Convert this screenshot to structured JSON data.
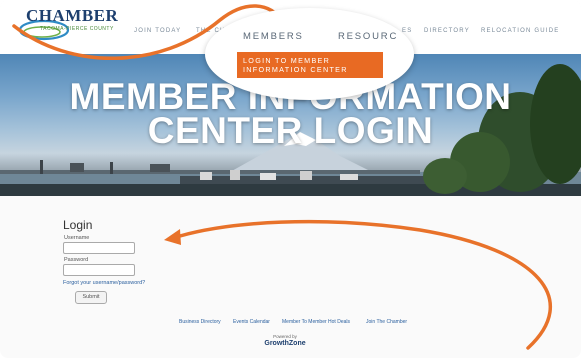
{
  "header": {
    "logo_text": "CHAMBER",
    "logo_subtext": "TACOMA-PIERCE COUNTY",
    "nav": {
      "join_today": "JOIN TODAY",
      "partial_left": "THE CH",
      "partial_right": "ES",
      "directory": "DIRECTORY",
      "relocation_guide": "RELOCATION GUIDE"
    }
  },
  "callout": {
    "members": "MEMBERS",
    "resources": "RESOURC",
    "login_button": [
      "LOGIN TO MEMBER",
      "INFORMATION CENTER"
    ]
  },
  "hero": {
    "title_line1": "MEMBER INFORMATION",
    "title_line2": "CENTER LOGIN"
  },
  "login": {
    "title": "Login",
    "username_label": "Username",
    "password_label": "Password",
    "forgot_link": "Forgot your username/password?",
    "submit_label": "Submit"
  },
  "footer": {
    "links": [
      "Business Directory",
      "Events Calendar",
      "Member To Member Hot Deals",
      "Join The Chamber"
    ],
    "powered_by": "Powered by",
    "brand": "GrowthZone"
  },
  "colors": {
    "accent_orange": "#e86a23",
    "brand_navy": "#1d3f6e",
    "link_blue": "#2a5f9e"
  }
}
